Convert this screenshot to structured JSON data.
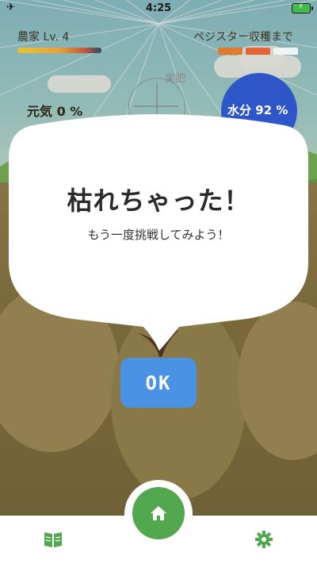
{
  "status_bar": {
    "time": "4:25"
  },
  "hud": {
    "level_label": "農家 Lv. 4",
    "harvest_label": "ペジスター収穫まで",
    "fertilizer_label": "実肥",
    "genki_label": "元気 0 %",
    "water_label": "水分 92 %",
    "colors": {
      "harvest_filled": "#e07a2e",
      "harvest_partial": "#e0633a",
      "harvest_empty": "#f2f2f2",
      "water": "#2f56c9"
    }
  },
  "dialog": {
    "title": "枯れちゃった！",
    "message": "もう一度挑戦してみよう！",
    "ok_label": "OK"
  },
  "bottom_nav": {
    "left_icon": "book-icon",
    "center_icon": "home-icon",
    "right_icon": "gear-icon",
    "accent": "#52a74f"
  }
}
